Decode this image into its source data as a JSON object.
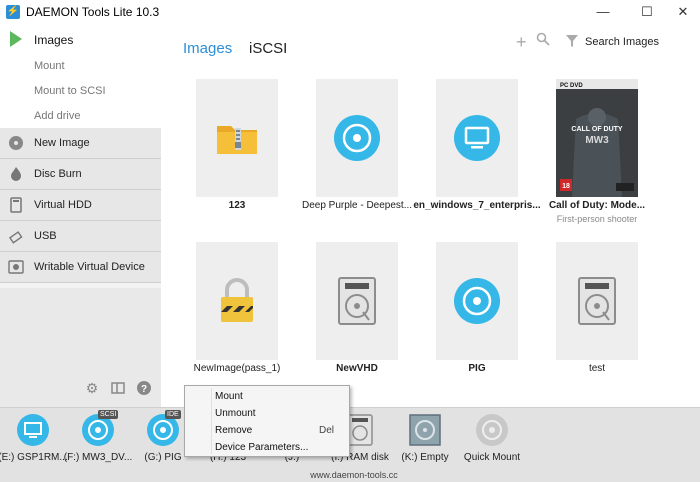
{
  "window": {
    "title": "DAEMON Tools Lite 10.3",
    "minimize": "—",
    "maximize": "☐",
    "close": "✕"
  },
  "sidebar": {
    "images_label": "Images",
    "sub_items": [
      "Mount",
      "Mount to SCSI",
      "Add drive"
    ],
    "sections": [
      {
        "label": "New Image",
        "icon": "new-image-icon"
      },
      {
        "label": "Disc Burn",
        "icon": "disc-burn-icon"
      },
      {
        "label": "Virtual HDD",
        "icon": "virtual-hdd-icon"
      },
      {
        "label": "USB",
        "icon": "usb-icon"
      },
      {
        "label": "Writable Virtual Device",
        "icon": "writable-device-icon"
      }
    ],
    "tools": [
      "gear-icon",
      "layout-icon",
      "help-icon"
    ]
  },
  "tabs": {
    "images": "Images",
    "iscsi": "iSCSI"
  },
  "toolbar": {
    "add": "+",
    "search_label": "Search Images"
  },
  "images": [
    {
      "name": "123",
      "icon": "archive-folder-icon",
      "bold": true
    },
    {
      "name": "Deep Purple - Deepest...",
      "icon": "disc-icon",
      "bold": false
    },
    {
      "name": "en_windows_7_enterpris...",
      "icon": "monitor-icon",
      "bold": true
    },
    {
      "name": "Call of Duty: Mode...",
      "icon": "game-cover",
      "bold": true,
      "subtitle": "First-person shooter",
      "cover_text": {
        "top": "PC DVD",
        "title": "CALL OF DUTY",
        "sub": "MW3",
        "rating": "18"
      }
    },
    {
      "name": "NewImage(pass_1)",
      "icon": "lock-icon",
      "bold": false
    },
    {
      "name": "NewVHD",
      "icon": "hdd-icon",
      "bold": true
    },
    {
      "name": "PIG",
      "icon": "disc-icon",
      "bold": true
    },
    {
      "name": "test",
      "icon": "hdd-icon",
      "bold": false
    }
  ],
  "drives": [
    {
      "label": "(E:) GSP1RM...",
      "icon": "monitor-icon",
      "badge": ""
    },
    {
      "label": "(F:) MW3_DV...",
      "icon": "disc-icon",
      "badge": "SCSI"
    },
    {
      "label": "(G:) PIG",
      "icon": "disc-icon",
      "badge": "IDE"
    },
    {
      "label": "(H:) 123",
      "icon": "disc-icon",
      "badge": ""
    },
    {
      "label": "(J:)",
      "icon": "disc-icon",
      "badge": ""
    },
    {
      "label": "(I:) RAM disk",
      "icon": "hdd-icon",
      "badge": ""
    },
    {
      "label": "(K:) Empty",
      "icon": "empty-hdd-icon",
      "badge": ""
    },
    {
      "label": "Quick Mount",
      "icon": "quick-mount-icon",
      "badge": ""
    }
  ],
  "footer_url": "www.daemon-tools.cc",
  "context_menu": [
    {
      "label": "Mount",
      "shortcut": ""
    },
    {
      "label": "Unmount",
      "shortcut": ""
    },
    {
      "label": "Remove",
      "shortcut": "Del"
    },
    {
      "label": "Device Parameters...",
      "shortcut": ""
    }
  ],
  "colors": {
    "accent": "#2a8fd8",
    "play": "#5cb85c",
    "lock": "#f0c33c"
  }
}
